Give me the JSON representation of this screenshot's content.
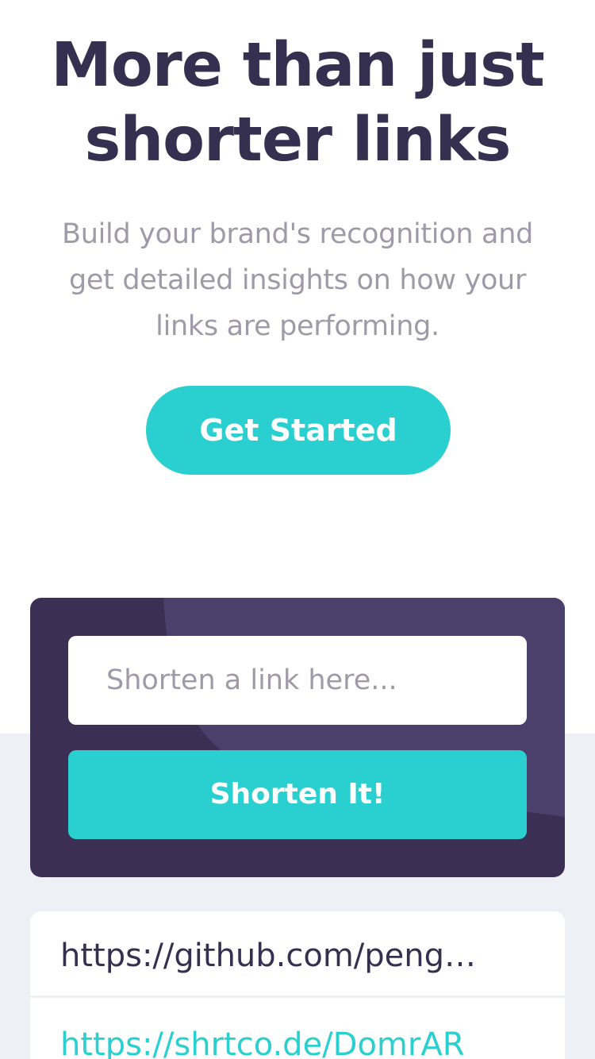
{
  "hero": {
    "title_line1": "More than just",
    "title_line2": "shorter links",
    "subtitle_line1": "Build your brand's recognition and",
    "subtitle_line2": "get detailed insights on how your",
    "subtitle_line3": "links are performing.",
    "cta_label": "Get Started"
  },
  "shortener": {
    "input_placeholder": "Shorten a link here...",
    "input_value": "",
    "button_label": "Shorten It!"
  },
  "results": [
    {
      "original_url": "https://github.com/peng…",
      "short_url": "https://shrtco.de/DomrAR"
    }
  ],
  "colors": {
    "primary_cyan": "#2acfcf",
    "dark_violet": "#3b3054",
    "heading_text": "#35304f",
    "muted_text": "#9e9aa8",
    "light_gray_bg": "#eff0f6"
  }
}
